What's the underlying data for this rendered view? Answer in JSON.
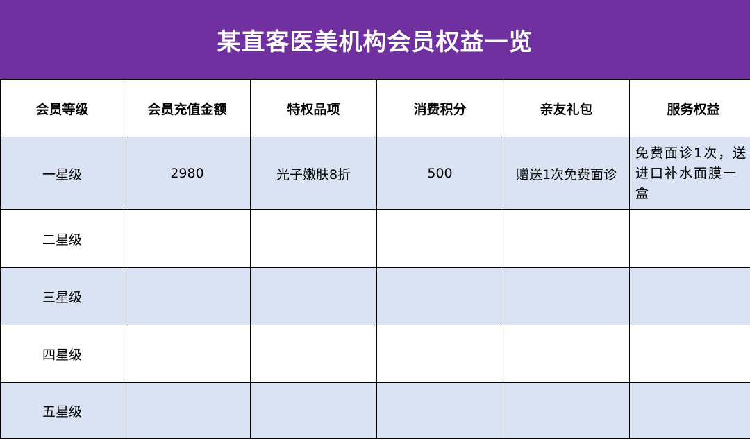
{
  "title": "某直客医美机构会员权益一览",
  "colors": {
    "title_background": "#7030a0",
    "title_text": "#ffffff",
    "row_shaded": "#dae3f3",
    "row_plain": "#ffffff",
    "border": "#000000"
  },
  "table": {
    "headers": [
      "会员等级",
      "会员充值金额",
      "特权品项",
      "消费积分",
      "亲友礼包",
      "服务权益"
    ],
    "rows": [
      [
        "一星级",
        "2980",
        "光子嫩肤8折",
        "500",
        "赠送1次免费面诊",
        "免费面诊1次，送进口补水面膜一盒"
      ],
      [
        "二星级",
        "",
        "",
        "",
        "",
        ""
      ],
      [
        "三星级",
        "",
        "",
        "",
        "",
        ""
      ],
      [
        "四星级",
        "",
        "",
        "",
        "",
        ""
      ],
      [
        "五星级",
        "",
        "",
        "",
        "",
        ""
      ]
    ]
  }
}
